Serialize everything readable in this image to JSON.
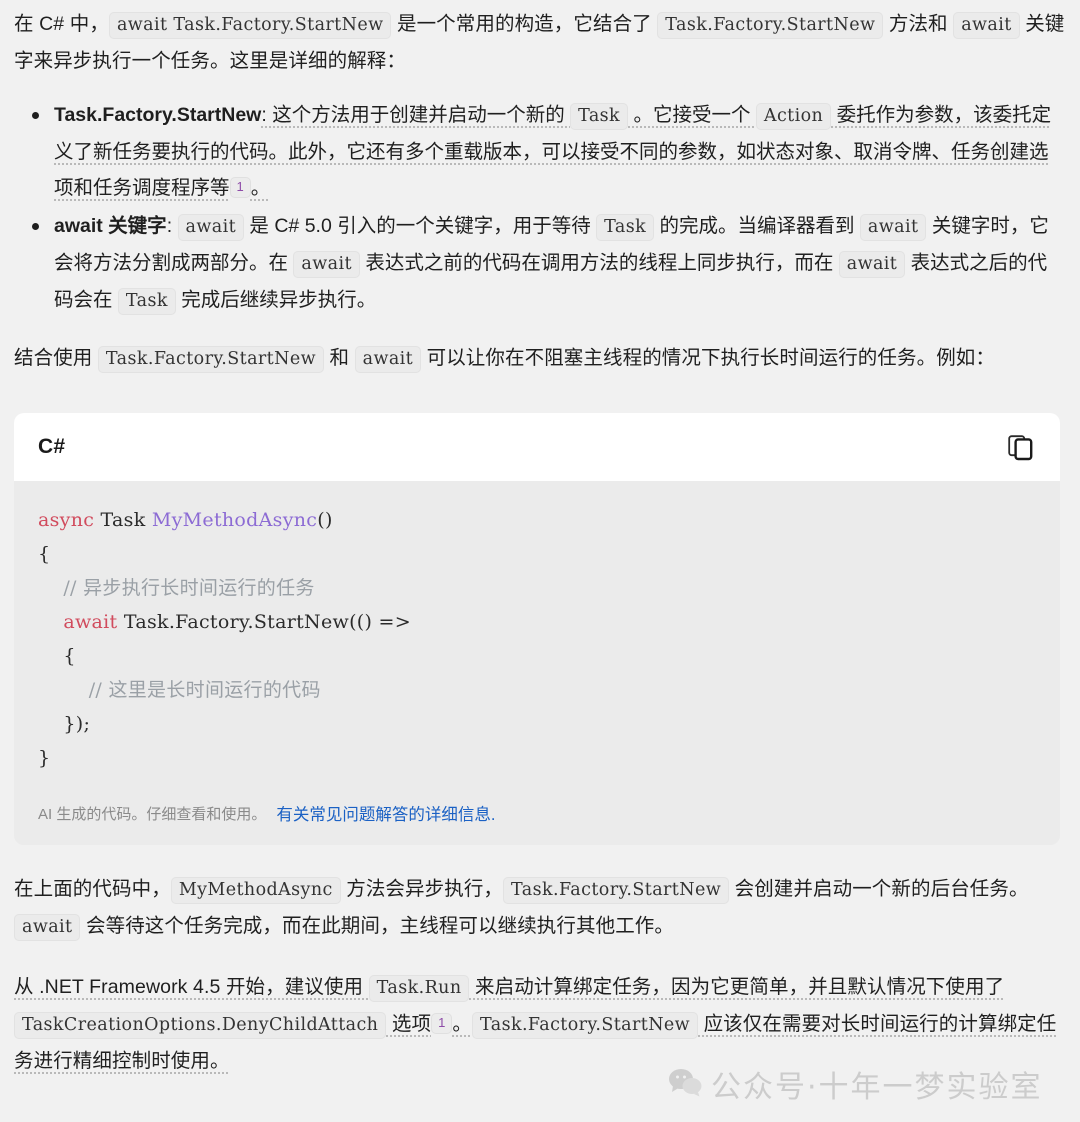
{
  "intro": {
    "t1": "在 C# 中，",
    "c1": "await Task.Factory.StartNew",
    "t2": " 是一个常用的构造，它结合了 ",
    "c2": "Task.Factory.StartNew",
    "t3": " 方法和 ",
    "c3": "await",
    "t4": " 关键字来异步执行一个任务。这里是详细的解释："
  },
  "bullets": [
    {
      "lead": "Task.Factory.StartNew",
      "t1": ": 这个方法用于创建并启动一个新的 ",
      "c1": "Task",
      "t2": " 。它接受一个 ",
      "c2": "Action",
      "t3": " 委托作为参数，该委托定义了新任务要执行的代码。此外，它还有多个重载版本，可以接受不同的参数，如状态对象、取消令牌、任务创建选项和任务调度程序等",
      "cite": "1",
      "t4": "。"
    },
    {
      "lead": "await 关键字",
      "t1": ": ",
      "c1": "await",
      "t2": " 是 C# 5.0 引入的一个关键字，用于等待 ",
      "c2": "Task",
      "t3": " 的完成。当编译器看到 ",
      "c3": "await",
      "t4": " 关键字时，它会将方法分割成两部分。在 ",
      "c4": "await",
      "t5": " 表达式之前的代码在调用方法的线程上同步执行，而在 ",
      "c5": "await",
      "t6": " 表达式之后的代码会在 ",
      "c6": "Task",
      "t7": " 完成后继续异步执行。"
    }
  ],
  "combine": {
    "t1": "结合使用 ",
    "c1": "Task.Factory.StartNew",
    "t2": " 和 ",
    "c2": "await",
    "t3": " 可以让你在不阻塞主线程的情况下执行长时间运行的任务。例如："
  },
  "code_block": {
    "language": "C#",
    "copy_icon": "copy-icon",
    "lines": {
      "l1_kw": "async",
      "l1_type": " Task ",
      "l1_fn": "MyMethodAsync",
      "l1_rest": "()",
      "l2": "{",
      "l3_comment": "    // 异步执行长时间运行的任务",
      "l4_indent": "    ",
      "l4_kw": "await",
      "l4_rest": " Task.Factory.StartNew(() =>",
      "l5": "    {",
      "l6_comment": "        // 这里是长时间运行的代码",
      "l7": "    });",
      "l8": "}"
    },
    "footer_note": "AI 生成的代码。仔细查看和使用。",
    "footer_link": "有关常见问题解答的详细信息."
  },
  "after_code": {
    "t1": "在上面的代码中，",
    "c1": "MyMethodAsync",
    "t2": " 方法会异步执行，",
    "c2": "Task.Factory.StartNew",
    "t3": " 会创建并启动一个新的后台任务。",
    "c3": "await",
    "t4": " 会等待这个任务完成，而在此期间，主线程可以继续执行其他工作。"
  },
  "net_para": {
    "t1": "从 .NET Framework 4.5 开始，建议使用 ",
    "c1": "Task.Run",
    "t2": " 来启动计算绑定任务，因为它更简单，并且默认情况下使用了 ",
    "c2": "TaskCreationOptions.DenyChildAttach",
    "t3": " 选项",
    "cite": "1",
    "t4": "。",
    "c3": "Task.Factory.StartNew",
    "t5": " 应该仅在需要对长时间运行的计算绑定任务进行精细控制时使用。"
  },
  "watermark": {
    "icon": "wechat-bubble-icon",
    "text": "公众号·十年一梦实验室"
  },
  "colors": {
    "page_bg": "#f1f1f1",
    "code_bg": "#ebebeb",
    "code_head_bg": "#ffffff",
    "keyword": "#d14b5d",
    "function": "#8c6bd4",
    "comment": "#9aa0a6",
    "link": "#1b61c4",
    "citation": "#8e4ca8"
  }
}
